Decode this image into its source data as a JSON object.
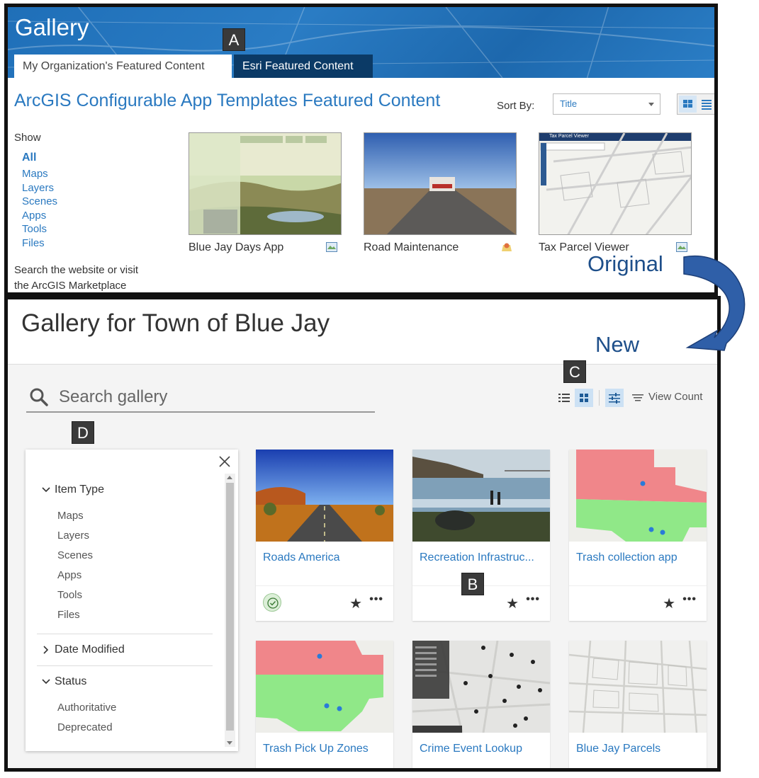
{
  "labels": {
    "original": "Original",
    "new": "New",
    "callout_a": "A",
    "callout_b": "B",
    "callout_c": "C",
    "callout_d": "D"
  },
  "original": {
    "title": "Gallery",
    "tabs": [
      {
        "label": "My Organization's Featured Content",
        "active": true
      },
      {
        "label": "Esri Featured Content",
        "active": false
      }
    ],
    "featured_title": "ArcGIS Configurable App Templates Featured Content",
    "sort": {
      "label": "Sort By:",
      "value": "Title"
    },
    "show_label": "Show",
    "filters": [
      "All",
      "Maps",
      "Layers",
      "Scenes",
      "Apps",
      "Tools",
      "Files"
    ],
    "search_note": "Search the website or visit the ArcGIS Marketplace",
    "items": [
      {
        "name": "Blue Jay Days App",
        "type_icon": "web-app-icon"
      },
      {
        "name": "Road Maintenance",
        "type_icon": "map-pin-icon"
      },
      {
        "name": "Tax Parcel Viewer",
        "type_icon": "web-app-icon",
        "thumb_title": "Tax Parcel Viewer"
      }
    ]
  },
  "new": {
    "title": "Gallery for Town of Blue Jay",
    "search": {
      "placeholder": "Search gallery",
      "value": ""
    },
    "toolbar": {
      "sort_label": "View Count"
    },
    "filter_panel": {
      "sections": [
        {
          "label": "Item Type",
          "expanded": true,
          "items": [
            "Maps",
            "Layers",
            "Scenes",
            "Apps",
            "Tools",
            "Files"
          ]
        },
        {
          "label": "Date Modified",
          "expanded": false,
          "items": []
        },
        {
          "label": "Status",
          "expanded": true,
          "items": [
            "Authoritative",
            "Deprecated"
          ]
        }
      ]
    },
    "cards": [
      {
        "title": "Roads America",
        "authoritative": true
      },
      {
        "title": "Recreation Infrastruc...",
        "authoritative": false
      },
      {
        "title": "Trash collection app",
        "authoritative": false
      },
      {
        "title": "Trash Pick Up Zones",
        "authoritative": false
      },
      {
        "title": "Crime Event Lookup",
        "authoritative": false
      },
      {
        "title": "Blue Jay Parcels",
        "authoritative": false
      }
    ]
  },
  "colors": {
    "accent": "#2a79c0",
    "header_blue": "#1f6fb8",
    "tab_dark": "#0b3a66",
    "annotation": "#1e4f8a"
  }
}
